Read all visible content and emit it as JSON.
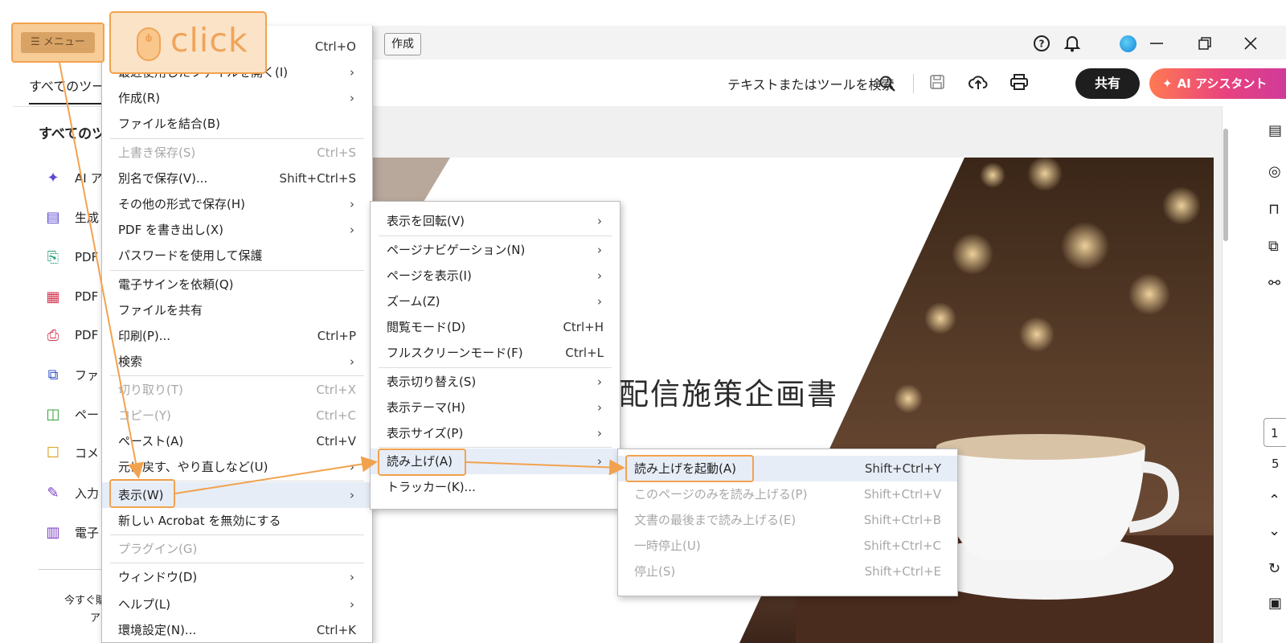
{
  "header": {
    "menu_button_label": "メニュー",
    "tab_label": "作成",
    "search_label": "テキストまたはツールを検索",
    "share_label": "共有",
    "ai_label": "AI アシスタント"
  },
  "left_panel": {
    "tab_label": "すべてのツー",
    "heading": "すべてのツ",
    "tools": [
      {
        "label": "AI ア",
        "icon": "ai-assistant-icon"
      },
      {
        "label": "生成",
        "icon": "generate-icon"
      },
      {
        "label": "PDF",
        "icon": "export-pdf-icon"
      },
      {
        "label": "PDF",
        "icon": "edit-pdf-icon"
      },
      {
        "label": "PDF",
        "icon": "create-pdf-icon"
      },
      {
        "label": "ファ",
        "icon": "combine-files-icon"
      },
      {
        "label": "ペー",
        "icon": "organize-pages-icon"
      },
      {
        "label": "コメ",
        "icon": "comment-icon"
      },
      {
        "label": "入力",
        "icon": "fill-sign-icon"
      },
      {
        "label": "電子",
        "icon": "e-sign-icon"
      }
    ],
    "footer_line1": "今すぐ購",
    "footer_line2": "ア"
  },
  "document": {
    "title": "配信施策企画書",
    "page_number": "1",
    "page_total": "5"
  },
  "menu_main": {
    "items": [
      {
        "label": "",
        "shortcut": "Ctrl+O",
        "submenu": false,
        "disabled": false
      },
      {
        "label": "最近使用したファイルを開く(I)",
        "shortcut": "",
        "submenu": true,
        "disabled": false
      },
      {
        "label": "作成(R)",
        "shortcut": "",
        "submenu": true,
        "disabled": false
      },
      {
        "label": "ファイルを結合(B)",
        "shortcut": "",
        "submenu": false,
        "disabled": false
      },
      {
        "label": "上書き保存(S)",
        "shortcut": "Ctrl+S",
        "submenu": false,
        "disabled": true
      },
      {
        "label": "別名で保存(V)...",
        "shortcut": "Shift+Ctrl+S",
        "submenu": false,
        "disabled": false
      },
      {
        "label": "その他の形式で保存(H)",
        "shortcut": "",
        "submenu": true,
        "disabled": false
      },
      {
        "label": "PDF を書き出し(X)",
        "shortcut": "",
        "submenu": true,
        "disabled": false
      },
      {
        "label": "パスワードを使用して保護",
        "shortcut": "",
        "submenu": false,
        "disabled": false
      },
      {
        "label": "電子サインを依頼(Q)",
        "shortcut": "",
        "submenu": false,
        "disabled": false
      },
      {
        "label": "ファイルを共有",
        "shortcut": "",
        "submenu": false,
        "disabled": false
      },
      {
        "label": "印刷(P)...",
        "shortcut": "Ctrl+P",
        "submenu": false,
        "disabled": false
      },
      {
        "label": "検索",
        "shortcut": "",
        "submenu": true,
        "disabled": false
      },
      {
        "label": "切り取り(T)",
        "shortcut": "Ctrl+X",
        "submenu": false,
        "disabled": true
      },
      {
        "label": "コピー(Y)",
        "shortcut": "Ctrl+C",
        "submenu": false,
        "disabled": true
      },
      {
        "label": "ペースト(A)",
        "shortcut": "Ctrl+V",
        "submenu": false,
        "disabled": false
      },
      {
        "label": "元に戻す、やり直しなど(U)",
        "shortcut": "",
        "submenu": true,
        "disabled": false
      },
      {
        "label": "表示(W)",
        "shortcut": "",
        "submenu": true,
        "disabled": false,
        "highlighted": true
      },
      {
        "label": "新しい Acrobat を無効にする",
        "shortcut": "",
        "submenu": false,
        "disabled": false
      },
      {
        "label": "プラグイン(G)",
        "shortcut": "",
        "submenu": false,
        "disabled": true
      },
      {
        "label": "ウィンドウ(D)",
        "shortcut": "",
        "submenu": true,
        "disabled": false
      },
      {
        "label": "ヘルプ(L)",
        "shortcut": "",
        "submenu": true,
        "disabled": false
      },
      {
        "label": "環境設定(N)...",
        "shortcut": "Ctrl+K",
        "submenu": false,
        "disabled": false
      }
    ]
  },
  "menu_view": {
    "items": [
      {
        "label": "表示を回転(V)",
        "shortcut": "",
        "submenu": true
      },
      {
        "label": "ページナビゲーション(N)",
        "shortcut": "",
        "submenu": true
      },
      {
        "label": "ページを表示(I)",
        "shortcut": "",
        "submenu": true
      },
      {
        "label": "ズーム(Z)",
        "shortcut": "",
        "submenu": true
      },
      {
        "label": "閲覧モード(D)",
        "shortcut": "Ctrl+H",
        "submenu": false
      },
      {
        "label": "フルスクリーンモード(F)",
        "shortcut": "Ctrl+L",
        "submenu": false
      },
      {
        "label": "表示切り替え(S)",
        "shortcut": "",
        "submenu": true
      },
      {
        "label": "表示テーマ(H)",
        "shortcut": "",
        "submenu": true
      },
      {
        "label": "表示サイズ(P)",
        "shortcut": "",
        "submenu": true
      },
      {
        "label": "読み上げ(A)",
        "shortcut": "",
        "submenu": true,
        "highlighted": true
      },
      {
        "label": "トラッカー(K)...",
        "shortcut": "",
        "submenu": false
      }
    ]
  },
  "menu_read": {
    "items": [
      {
        "label": "読み上げを起動(A)",
        "shortcut": "Shift+Ctrl+Y",
        "disabled": false,
        "highlighted": true
      },
      {
        "label": "このページのみを読み上げる(P)",
        "shortcut": "Shift+Ctrl+V",
        "disabled": true
      },
      {
        "label": "文書の最後まで読み上げる(E)",
        "shortcut": "Shift+Ctrl+B",
        "disabled": true
      },
      {
        "label": "一時停止(U)",
        "shortcut": "Shift+Ctrl+C",
        "disabled": true
      },
      {
        "label": "停止(S)",
        "shortcut": "Shift+Ctrl+E",
        "disabled": true
      }
    ]
  },
  "overlay": {
    "click_label": "click",
    "accent_color": "#f2a24e"
  }
}
